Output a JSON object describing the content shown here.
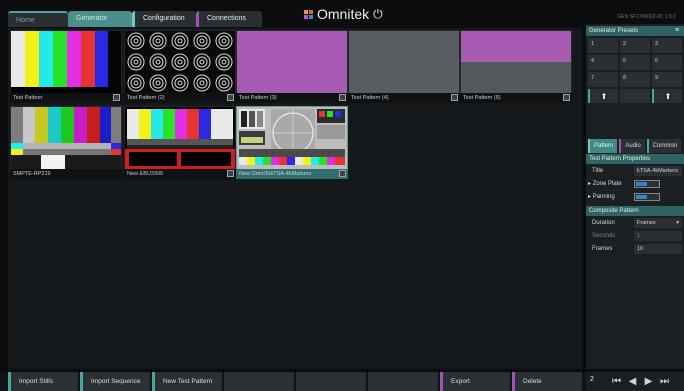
{
  "tabs": [
    "Home",
    "Generator",
    "Configuration",
    "Connections"
  ],
  "logo": {
    "text": "Omnitek"
  },
  "version": "GEN SF1706002-8C 1.9.0",
  "gallery": {
    "items": [
      {
        "caption": "Test Pattern"
      },
      {
        "caption": "Test Pattern (2)"
      },
      {
        "caption": "Test Pattern (3)"
      },
      {
        "caption": "Test Pattern (4)"
      },
      {
        "caption": "Test Pattern (5)"
      },
      {
        "caption": "SMPTE-RP219"
      },
      {
        "caption": "New EBU3305"
      },
      {
        "caption": "New OmniTekTSA-4kMarkers"
      }
    ]
  },
  "bottom_buttons": [
    "Import Stills",
    "Import Sequence",
    "New Test Pattern",
    "Export",
    "Delete"
  ],
  "panel": {
    "generator_presets_title": "Generator Presets",
    "presets": [
      "1",
      "2",
      "3",
      "4",
      "5",
      "6",
      "7",
      "8",
      "9"
    ],
    "tabs": [
      "Pattern",
      "Audio",
      "Common"
    ],
    "test_pattern_props_title": "Test Pattern Properties",
    "title_label": "Title",
    "title_value": "kTSA-4kMarkers",
    "zone_plate_label": "Zone Plate",
    "panning_label": "Panning",
    "composite_title": "Composite Pattern",
    "duration_label": "Duration",
    "duration_value": "Frames",
    "seconds_label": "Seconds",
    "seconds_value": "1",
    "frames_label": "Frames",
    "frames_value": "10"
  },
  "footer": {
    "preset_number": "2"
  },
  "colors": {
    "accent_teal": "#4aa7a0",
    "accent_purple": "#a453b5",
    "panel_header": "#2f6363"
  }
}
